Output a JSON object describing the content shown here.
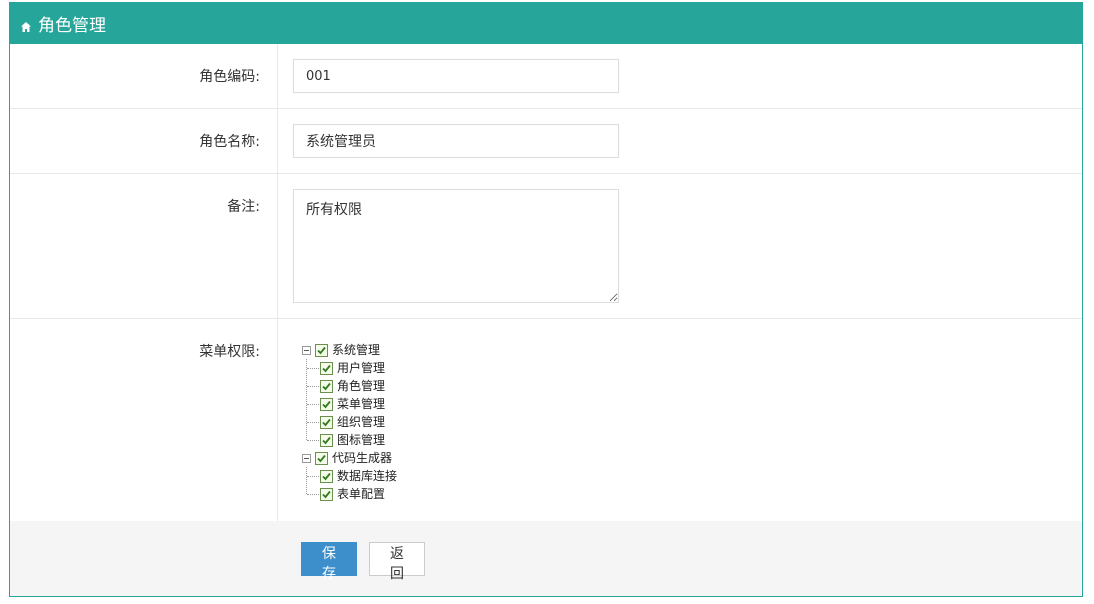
{
  "header": {
    "title": "角色管理",
    "icon": "home-icon"
  },
  "form": {
    "code_label": "角色编码:",
    "code_value": "001",
    "name_label": "角色名称:",
    "name_value": "系统管理员",
    "remark_label": "备注:",
    "remark_value": "所有权限",
    "menu_label": "菜单权限:"
  },
  "tree": {
    "groups": [
      {
        "label": "系统管理",
        "checked": true,
        "expanded": true,
        "children": [
          {
            "label": "用户管理",
            "checked": true
          },
          {
            "label": "角色管理",
            "checked": true
          },
          {
            "label": "菜单管理",
            "checked": true
          },
          {
            "label": "组织管理",
            "checked": true
          },
          {
            "label": "图标管理",
            "checked": true
          }
        ]
      },
      {
        "label": "代码生成器",
        "checked": true,
        "expanded": true,
        "children": [
          {
            "label": "数据库连接",
            "checked": true
          },
          {
            "label": "表单配置",
            "checked": true
          }
        ]
      }
    ]
  },
  "footer": {
    "save_label": "保存",
    "back_label": "返回"
  },
  "colors": {
    "accent": "#26a69a",
    "primary_button": "#3d8fcc"
  }
}
